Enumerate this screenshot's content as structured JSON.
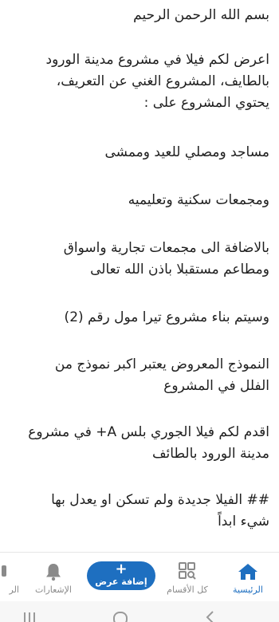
{
  "post": {
    "paragraphs": [
      [
        "بسم الله الرحمن الرحيم"
      ],
      [
        "اعرض لكم فيلا في مشروع مدينة الورود",
        "بالطايف، المشروع الغني عن التعريف،",
        "يحتوي المشروع على :"
      ],
      [
        "مساجد ومصلي للعيد وممشى"
      ],
      [
        "ومجمعات سكنية وتعليميه"
      ],
      [
        "بالاضافة الى مجمعات تجارية واسواق",
        "ومطاعم مستقبلا باذن الله تعالى"
      ],
      [
        "وسيتم بناء مشروع تيرا مول رقم (2)"
      ],
      [
        "النموذج المعروض يعتبر اكبر نموذج من",
        "الفلل في المشروع"
      ],
      [
        "اقدم لكم فيلا الجوري بلس A+ في مشروع",
        "مدينة الورود بالطائف"
      ],
      [
        "## الفيلا جديدة ولم تسكن او يعدل بها",
        "شيء ابداً"
      ]
    ]
  },
  "bottom_nav": {
    "home": {
      "label": "الرئيسية",
      "icon": "home-icon"
    },
    "categories": {
      "label": "كل الأقسام",
      "icon": "grid-search-icon"
    },
    "add_offer": {
      "label": "إضافة عرض",
      "plus": "+"
    },
    "notifications": {
      "label": "الإشعارات",
      "icon": "bell-icon"
    },
    "more": {
      "label": "الر"
    }
  },
  "colors": {
    "accent": "#1e6fc0",
    "inactive": "#8a8a8a",
    "text": "#1f1f1f"
  }
}
